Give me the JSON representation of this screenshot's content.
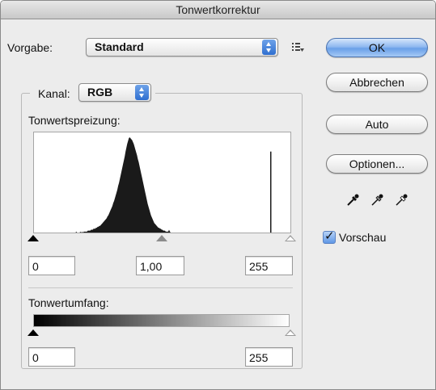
{
  "window": {
    "title": "Tonwertkorrektur"
  },
  "preset": {
    "label": "Vorgabe:",
    "value": "Standard",
    "menu_icon": "preset-options-icon"
  },
  "channel": {
    "label": "Kanal:",
    "value": "RGB"
  },
  "input_levels": {
    "label": "Tonwertspreizung:",
    "shadow": "0",
    "midtone": "1,00",
    "highlight": "255"
  },
  "output_levels": {
    "label": "Tonwertumfang:",
    "shadow": "0",
    "highlight": "255"
  },
  "buttons": {
    "ok": "OK",
    "cancel": "Abbrechen",
    "auto": "Auto",
    "options": "Optionen..."
  },
  "eyedroppers": [
    "black-eyedropper-icon",
    "gray-eyedropper-icon",
    "white-eyedropper-icon"
  ],
  "preview": {
    "label": "Vorschau",
    "checked": true
  },
  "histogram": {
    "bins_note": "relative heights sampled left to right",
    "values": [
      0,
      0,
      0,
      0,
      0,
      0,
      0,
      0,
      0,
      0,
      0,
      0,
      0,
      0,
      0,
      0,
      0,
      0,
      0,
      0,
      0,
      0,
      1,
      0,
      0,
      0,
      0,
      1,
      0,
      1,
      0,
      1,
      1,
      1,
      1,
      1,
      2,
      2,
      2,
      2,
      3,
      3,
      3,
      4,
      4,
      4,
      5,
      5,
      6,
      6,
      7,
      7,
      8,
      9,
      10,
      11,
      12,
      13,
      14,
      15,
      17,
      18,
      20,
      22,
      24,
      26,
      28,
      31,
      33,
      36,
      39,
      42,
      45,
      49,
      52,
      56,
      60,
      64,
      68,
      72,
      76,
      80,
      85,
      89,
      93,
      96,
      99,
      100,
      99,
      98,
      97,
      95,
      93,
      90,
      87,
      84,
      81,
      77,
      74,
      70,
      66,
      62,
      58,
      54,
      50,
      46,
      42,
      38,
      34,
      30,
      27,
      24,
      21,
      18,
      16,
      14,
      12,
      10,
      9,
      8,
      7,
      6,
      5,
      5,
      4,
      4,
      3,
      3,
      2,
      2,
      2,
      1,
      1,
      1,
      1,
      3,
      1,
      0,
      0,
      0,
      0,
      0,
      0,
      0,
      0,
      0,
      0,
      0,
      0,
      0,
      0,
      0,
      0,
      0,
      0,
      0,
      0,
      0,
      0,
      0,
      0,
      0,
      0,
      0,
      0,
      0,
      0,
      0,
      0,
      0,
      0,
      0,
      0,
      0,
      0,
      0,
      0,
      0,
      0,
      0,
      0,
      0,
      0,
      0,
      0,
      0,
      0,
      0,
      0,
      0,
      0,
      0,
      0,
      0,
      0,
      0,
      0,
      0,
      0,
      0,
      0,
      0,
      0,
      0,
      0,
      0,
      0,
      0,
      0,
      0,
      0,
      0,
      0,
      0,
      0,
      0,
      0,
      0,
      0,
      0,
      0,
      0,
      0,
      0,
      0,
      0,
      0,
      0,
      0,
      0,
      0,
      0,
      0,
      0,
      0,
      0,
      0,
      0,
      0,
      0,
      0,
      0,
      0,
      0,
      0,
      0,
      0,
      0,
      0,
      0,
      0,
      0,
      0,
      0,
      0,
      0,
      0,
      0,
      0,
      0,
      0,
      0,
      0,
      0,
      0,
      0,
      0,
      0,
      0,
      0,
      0
    ],
    "spike": 0.85,
    "fill": "#1a1a1a"
  }
}
